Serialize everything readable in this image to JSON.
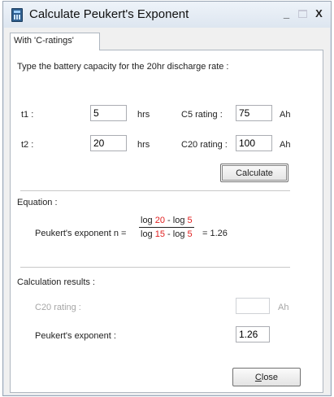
{
  "window": {
    "title": "Calculate Peukert's Exponent",
    "minimize_glyph": "_",
    "maximize_glyph": "",
    "close_glyph": "X"
  },
  "tab": {
    "label": "With 'C-ratings'"
  },
  "intro": "Type the battery capacity for the 20hr discharge rate :",
  "inputs": {
    "t1_label": "t1 :",
    "t1_value": "5",
    "t1_unit": "hrs",
    "t2_label": "t2 :",
    "t2_value": "20",
    "t2_unit": "hrs",
    "c5_label": "C5 rating :",
    "c5_value": "75",
    "c5_unit": "Ah",
    "c20_label": "C20 rating :",
    "c20_value": "100",
    "c20_unit": "Ah"
  },
  "calculate_button": "Calculate",
  "equation": {
    "heading": "Equation :",
    "prefix": "Peukert's exponent n =",
    "num_log1": "log",
    "num_val1": "20",
    "num_op": " - log ",
    "num_val2": "5",
    "den_log1": "log",
    "den_val1": "15",
    "den_op": " - log ",
    "den_val2": "5",
    "result": "= 1.26"
  },
  "results": {
    "heading": "Calculation results :",
    "c20_label": "C20 rating :",
    "c20_value": "",
    "c20_unit": "Ah",
    "exponent_label": "Peukert's exponent :",
    "exponent_value": "1.26"
  },
  "close_button": {
    "prefix": "",
    "mnemonic": "C",
    "rest": "lose"
  },
  "colors": {
    "highlight": "#e02020",
    "window_bg": "#f0f0f0"
  },
  "icons": [
    "battery-app-icon"
  ]
}
